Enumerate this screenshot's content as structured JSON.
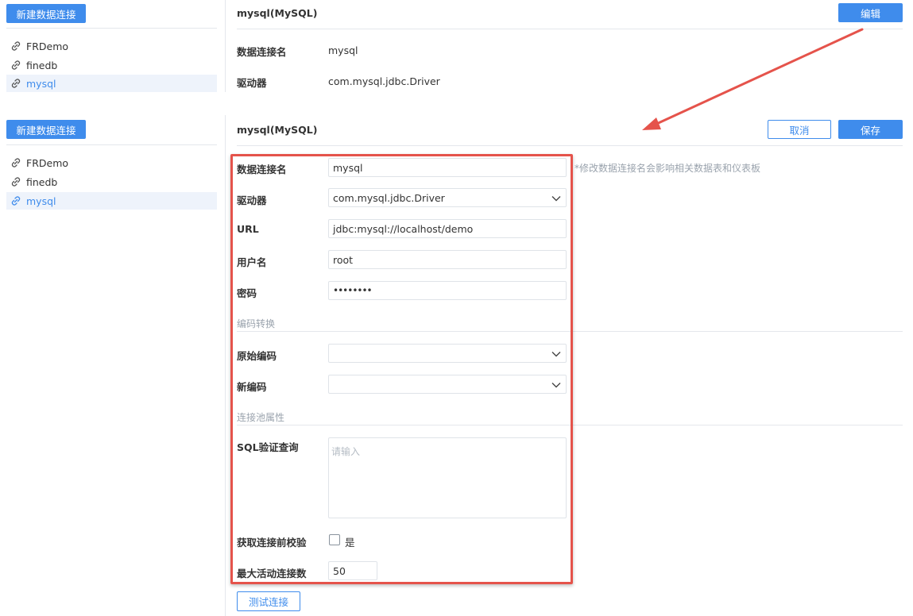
{
  "top_panel": {
    "new_conn_button": "新建数据连接",
    "connections": [
      "FRDemo",
      "finedb",
      "mysql"
    ],
    "title": "mysql(MySQL)",
    "edit_button": "编辑",
    "fields": [
      {
        "label": "数据连接名",
        "value": "mysql"
      },
      {
        "label": "驱动器",
        "value": "com.mysql.jdbc.Driver"
      }
    ]
  },
  "bottom_panel": {
    "new_conn_button": "新建数据连接",
    "connections": [
      "FRDemo",
      "finedb",
      "mysql"
    ],
    "active_connection": "mysql",
    "title": "mysql(MySQL)",
    "cancel_button": "取消",
    "save_button": "保存",
    "form": {
      "name_label": "数据连接名",
      "name_value": "mysql",
      "name_hint": "*修改数据连接名会影响相关数据表和仪表板",
      "driver_label": "驱动器",
      "driver_value": "com.mysql.jdbc.Driver",
      "url_label": "URL",
      "url_value": "jdbc:mysql://localhost/demo",
      "user_label": "用户名",
      "user_value": "root",
      "password_label": "密码",
      "password_value": "••••••••",
      "encoding_section": "编码转换",
      "orig_encoding_label": "原始编码",
      "orig_encoding_value": "",
      "new_encoding_label": "新编码",
      "new_encoding_value": "",
      "pool_section": "连接池属性",
      "sql_label": "SQL验证查询",
      "sql_placeholder": "请输入",
      "validate_label": "获取连接前校验",
      "validate_checkbox_label": "是",
      "validate_checked": false,
      "max_active_label": "最大活动连接数",
      "max_active_value": "50",
      "test_button": "测试连接"
    }
  },
  "colors": {
    "accent": "#3f8cec",
    "highlight_box": "#e5534b",
    "arrow": "#e5534b"
  }
}
